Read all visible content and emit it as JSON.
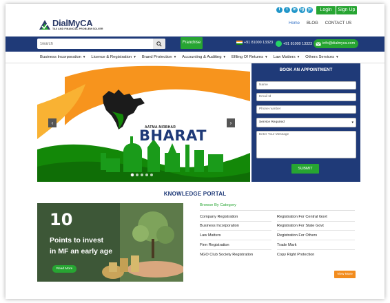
{
  "topbar": {
    "social": [
      "f",
      "t",
      "in",
      "ig",
      "yt"
    ],
    "login_label": "Login",
    "signup_label": "Sign Up"
  },
  "header": {
    "logo_name": "DialMyCA",
    "logo_tagline": "TAX AND FINANCIAL PROBLEM SOLVER",
    "nav": [
      "Home",
      "BLOG",
      "CONTACT US"
    ]
  },
  "bluebar": {
    "search_placeholder": "Search",
    "franchise_label": "Franchise",
    "phone_1": "+91 81000 13323",
    "phone_2": "+91 81000 13323",
    "email": "info@dialmyca.com"
  },
  "menu": {
    "items": [
      "Business Incorporation",
      "Licence & Registration",
      "Brand Protection",
      "Accounting & Auditing",
      "Efiling Of Returns",
      "Law Matters",
      "Others Services"
    ]
  },
  "hero": {
    "kicker": "AATMA-NIRBHAR",
    "headline": "BHARAT",
    "slides": 5,
    "active_slide": 1
  },
  "appointment": {
    "title": "BOOK AN APPOINTMENT",
    "name_placeholder": "Name",
    "email_placeholder": "Email Id",
    "phone_placeholder": "Phone number",
    "service_selected": "Service Required",
    "message_placeholder": "Enter Your Message",
    "submit_label": "SUBMIT"
  },
  "knowledge": {
    "title": "KNOWLEDGE PORTAL",
    "blog_number": "10",
    "blog_line1": "Points to invest",
    "blog_line2": "in MF an early age",
    "read_more": "Read More",
    "browse_title": "Browse By Category",
    "left_categories": [
      "Company Registration",
      "Business Incorporation",
      "Law Matters",
      "Firm Registration",
      "NGO Club Society Registration"
    ],
    "right_categories": [
      "Registration For Central Govt",
      "Registration For State Govt",
      "Registration For Others",
      "Trade Mark",
      "Copy Right Protection"
    ],
    "view_more": "View More"
  },
  "colors": {
    "navy": "#1f3a78",
    "green": "#27a532",
    "orange": "#f28c1e"
  }
}
